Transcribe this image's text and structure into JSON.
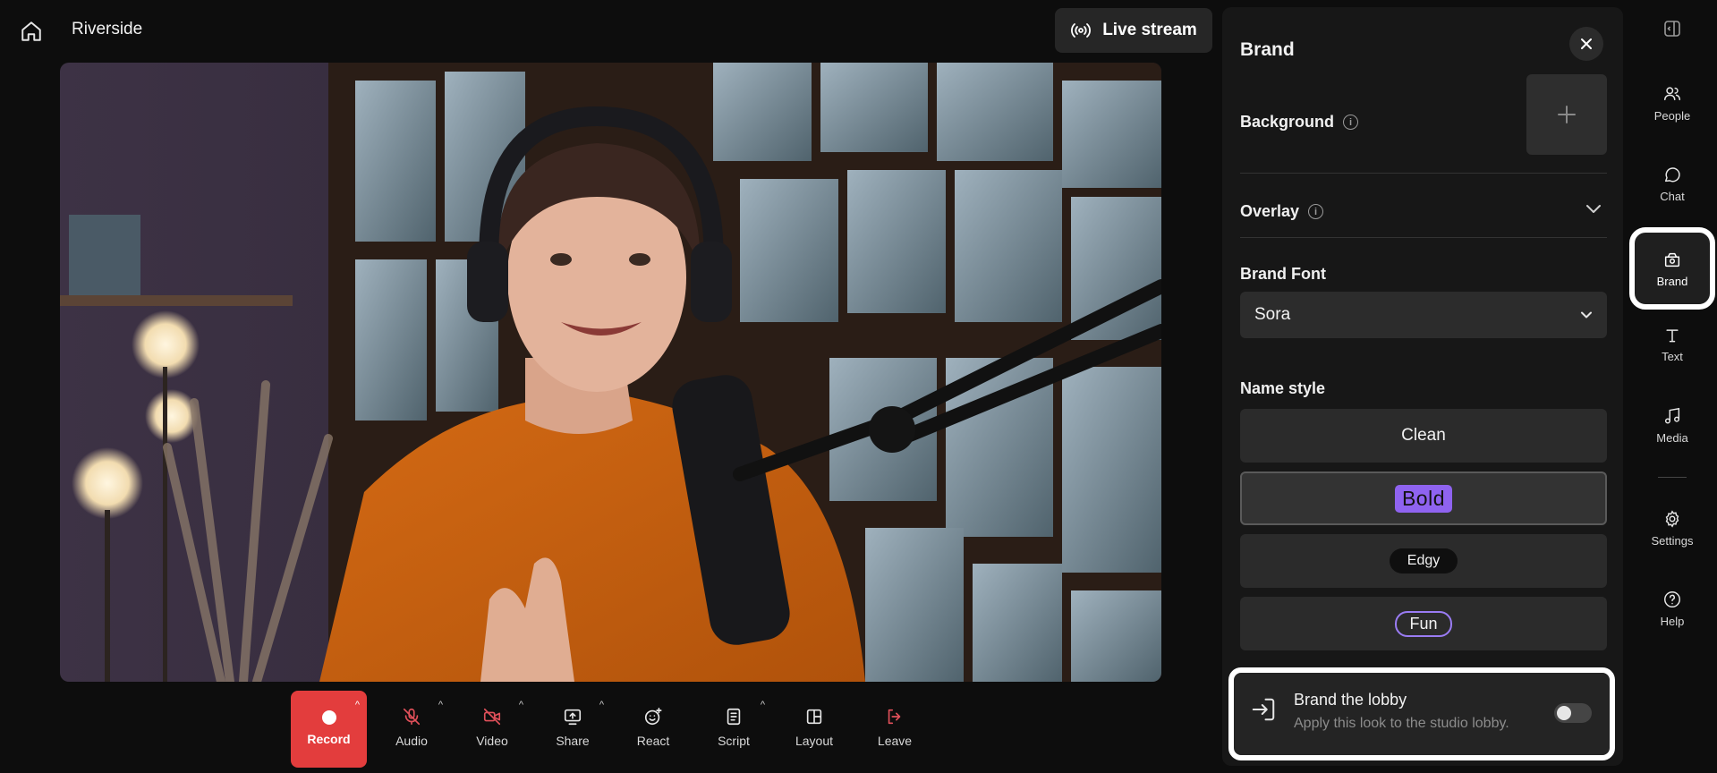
{
  "app": {
    "title": "Riverside"
  },
  "header": {
    "live_stream_label": "Live stream"
  },
  "toolbar": {
    "record": "Record",
    "audio": "Audio",
    "video": "Video",
    "share": "Share",
    "react": "React",
    "script": "Script",
    "layout": "Layout",
    "leave": "Leave"
  },
  "panel": {
    "title": "Brand",
    "background_label": "Background",
    "overlay_label": "Overlay",
    "brand_font_label": "Brand Font",
    "brand_font_value": "Sora",
    "name_style_label": "Name style",
    "name_styles": [
      "Clean",
      "Bold",
      "Edgy",
      "Fun"
    ],
    "selected_name_style": "Bold",
    "lobby": {
      "title": "Brand the lobby",
      "subtitle": "Apply this look to the studio lobby.",
      "enabled": false
    }
  },
  "rail": {
    "people": "People",
    "chat": "Chat",
    "brand": "Brand",
    "text": "Text",
    "media": "Media",
    "settings": "Settings",
    "help": "Help"
  },
  "colors": {
    "record": "#e33d3d",
    "accent_purple": "#8f63f0",
    "muted_red": "#e0505a"
  }
}
